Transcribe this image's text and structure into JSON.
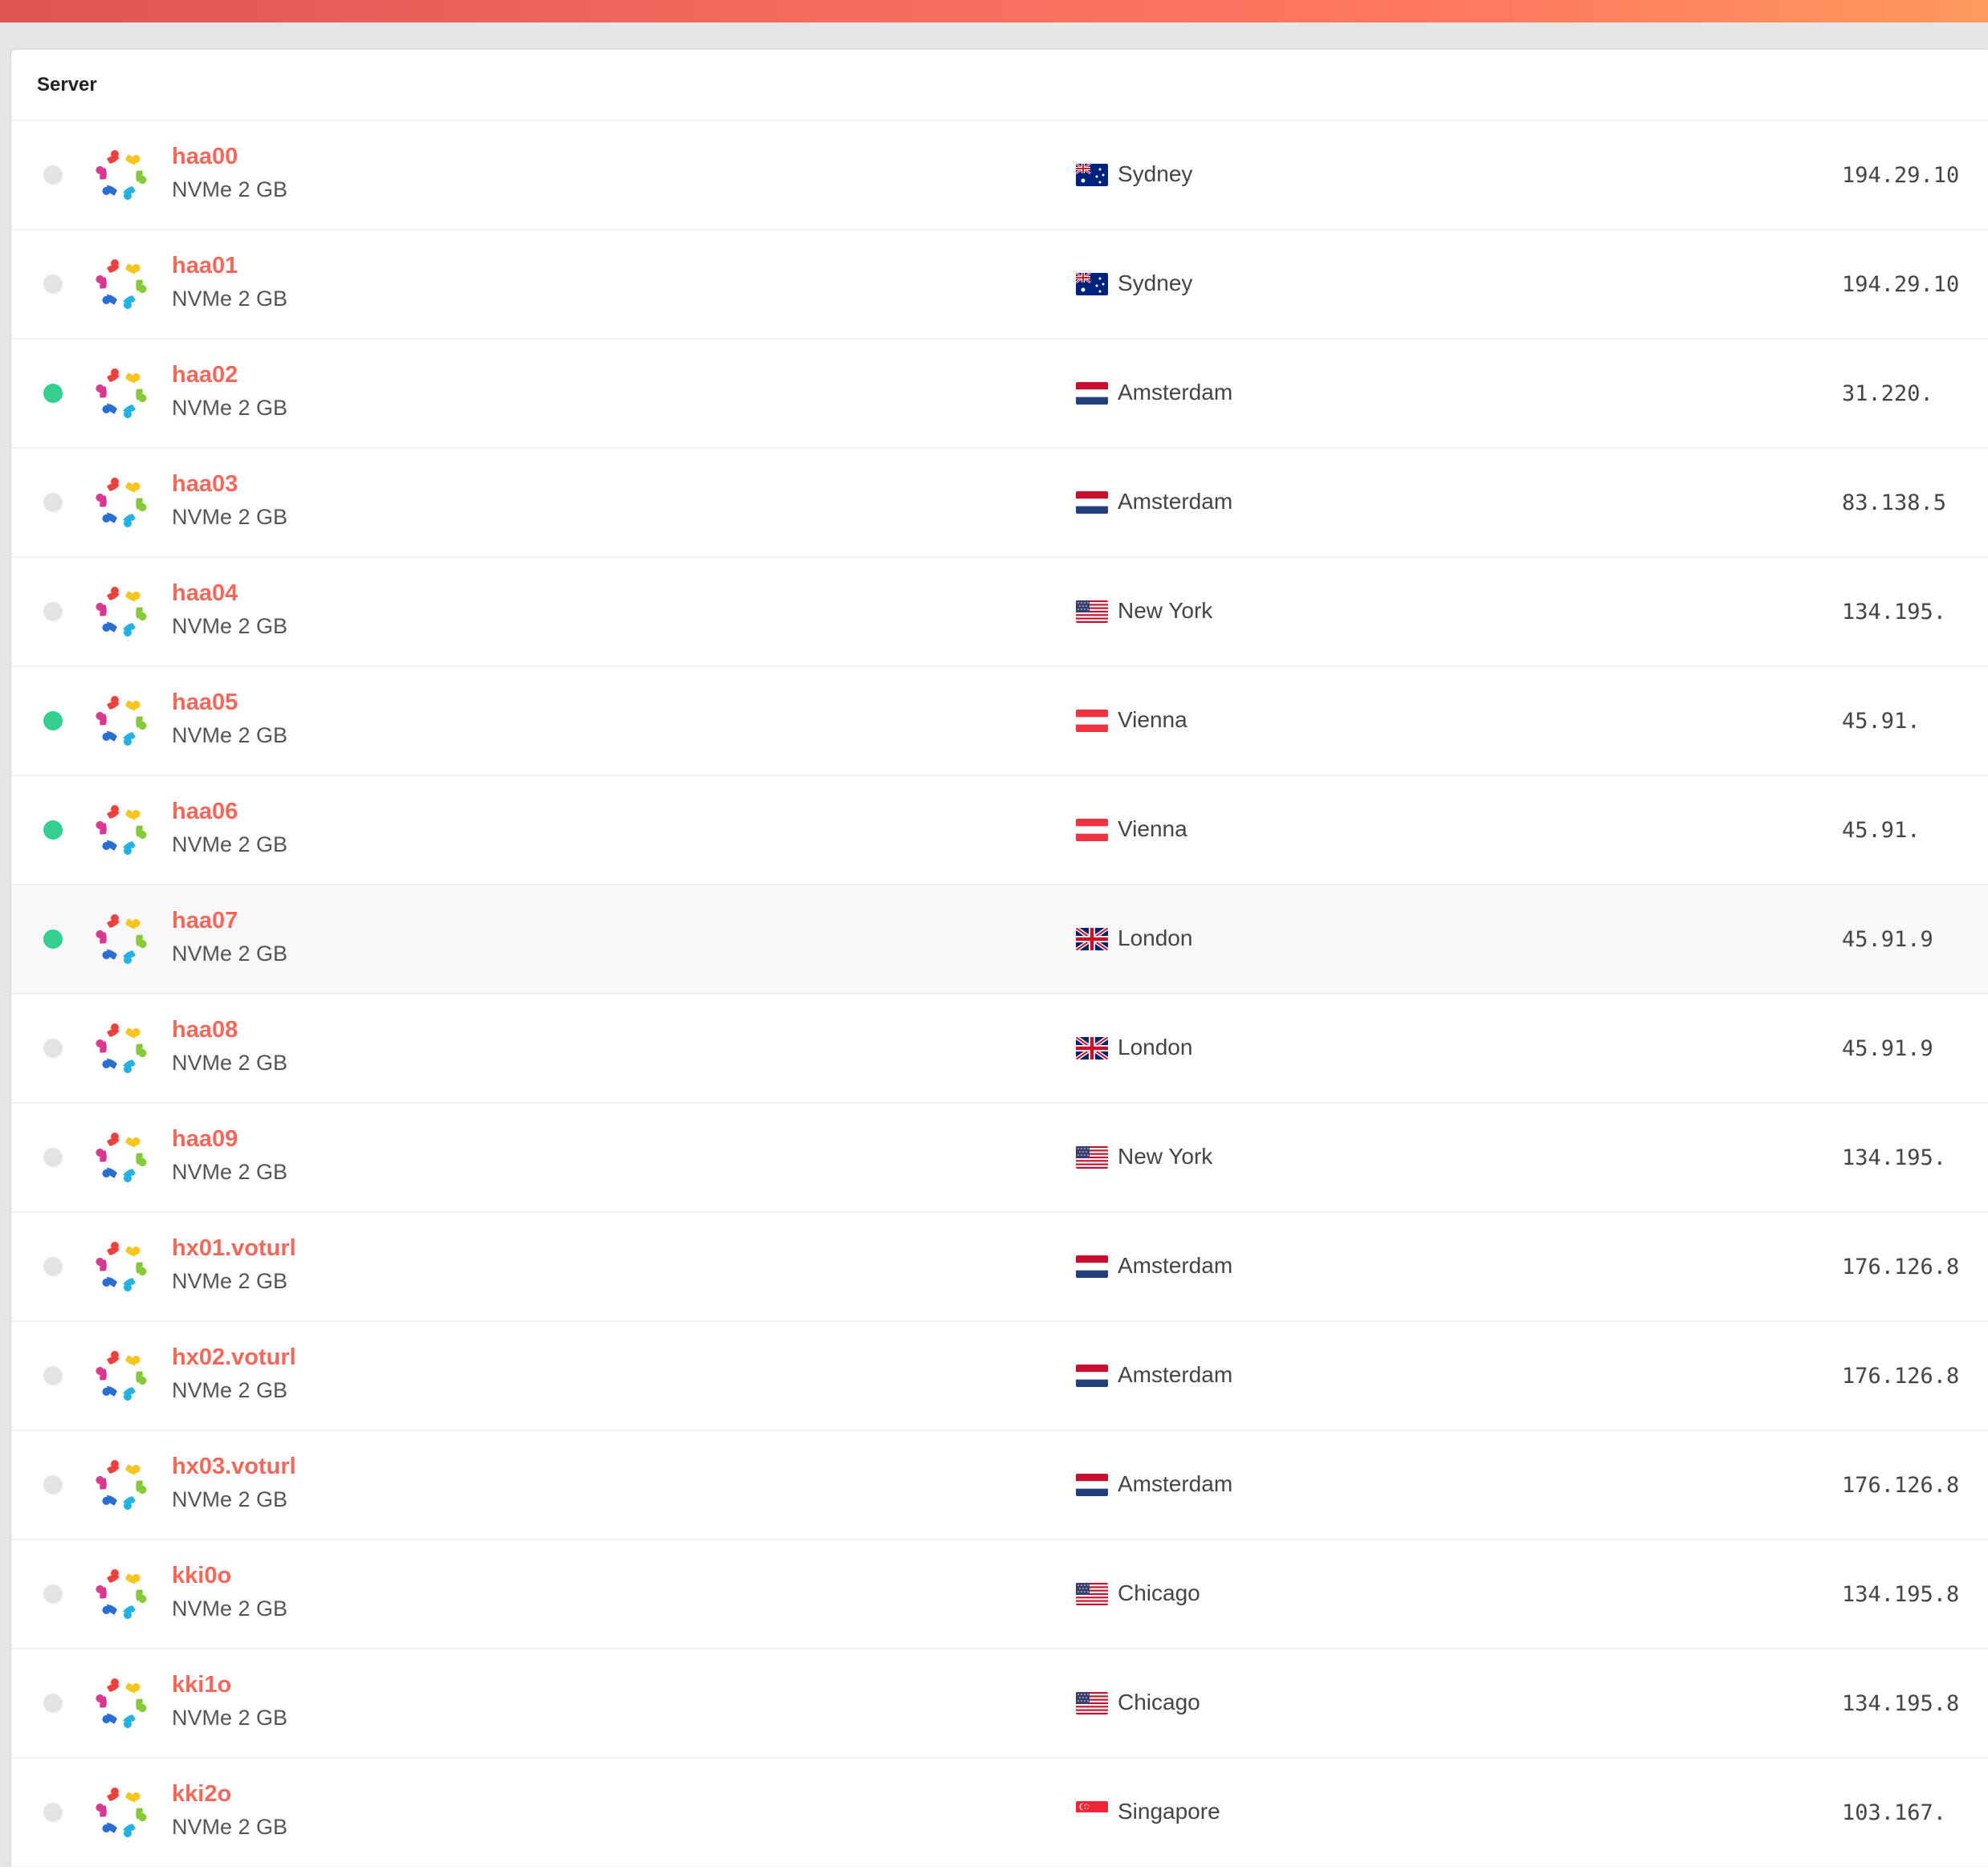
{
  "colors": {
    "accent": "#f3685a",
    "online": "#33d08f",
    "offline": "#e4e4e4"
  },
  "table": {
    "header_server": "Server",
    "rows": [
      {
        "name": "haa00",
        "plan": "NVMe 2 GB",
        "status": "offline",
        "flag": "au",
        "city": "Sydney",
        "ip": "194.29.10"
      },
      {
        "name": "haa01",
        "plan": "NVMe 2 GB",
        "status": "offline",
        "flag": "au",
        "city": "Sydney",
        "ip": "194.29.10"
      },
      {
        "name": "haa02",
        "plan": "NVMe 2 GB",
        "status": "online",
        "flag": "nl",
        "city": "Amsterdam",
        "ip": "31.220."
      },
      {
        "name": "haa03",
        "plan": "NVMe 2 GB",
        "status": "offline",
        "flag": "nl",
        "city": "Amsterdam",
        "ip": "83.138.5"
      },
      {
        "name": "haa04",
        "plan": "NVMe 2 GB",
        "status": "offline",
        "flag": "us",
        "city": "New York",
        "ip": "134.195."
      },
      {
        "name": "haa05",
        "plan": "NVMe 2 GB",
        "status": "online",
        "flag": "at",
        "city": "Vienna",
        "ip": "45.91."
      },
      {
        "name": "haa06",
        "plan": "NVMe 2 GB",
        "status": "online",
        "flag": "at",
        "city": "Vienna",
        "ip": "45.91."
      },
      {
        "name": "haa07",
        "plan": "NVMe 2 GB",
        "status": "online",
        "flag": "gb",
        "city": "London",
        "ip": "45.91.9",
        "highlight": true
      },
      {
        "name": "haa08",
        "plan": "NVMe 2 GB",
        "status": "offline",
        "flag": "gb",
        "city": "London",
        "ip": "45.91.9"
      },
      {
        "name": "haa09",
        "plan": "NVMe 2 GB",
        "status": "offline",
        "flag": "us",
        "city": "New York",
        "ip": "134.195."
      },
      {
        "name": "hx01.voturl",
        "plan": "NVMe 2 GB",
        "status": "offline",
        "flag": "nl",
        "city": "Amsterdam",
        "ip": "176.126.8"
      },
      {
        "name": "hx02.voturl",
        "plan": "NVMe 2 GB",
        "status": "offline",
        "flag": "nl",
        "city": "Amsterdam",
        "ip": "176.126.8"
      },
      {
        "name": "hx03.voturl",
        "plan": "NVMe 2 GB",
        "status": "offline",
        "flag": "nl",
        "city": "Amsterdam",
        "ip": "176.126.8"
      },
      {
        "name": "kki0o",
        "plan": "NVMe 2 GB",
        "status": "offline",
        "flag": "us",
        "city": "Chicago",
        "ip": "134.195.8"
      },
      {
        "name": "kki1o",
        "plan": "NVMe 2 GB",
        "status": "offline",
        "flag": "us",
        "city": "Chicago",
        "ip": "134.195.8"
      },
      {
        "name": "kki2o",
        "plan": "NVMe 2 GB",
        "status": "offline",
        "flag": "sg",
        "city": "Singapore",
        "ip": "103.167."
      }
    ]
  }
}
